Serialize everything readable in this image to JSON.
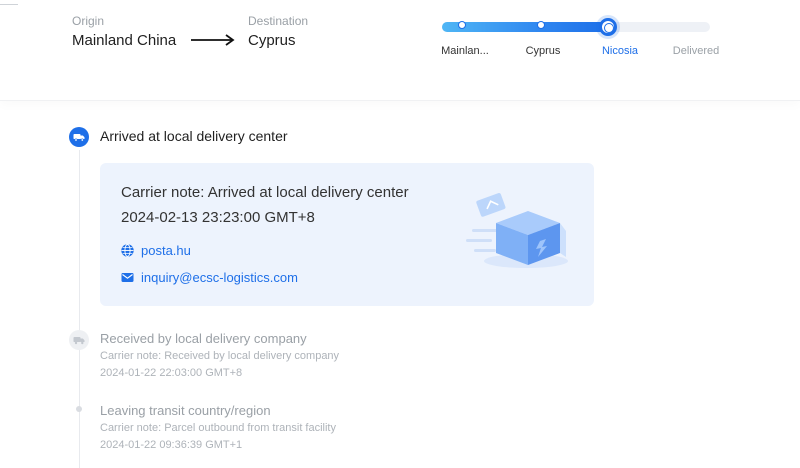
{
  "route": {
    "origin_label": "Origin",
    "origin_value": "Mainland China",
    "destination_label": "Destination",
    "destination_value": "Cyprus"
  },
  "progress": {
    "stages": [
      "Mainlan...",
      "Cyprus",
      "Nicosia",
      "Delivered"
    ],
    "current_stage": "Nicosia",
    "fill_fraction": 0.62
  },
  "events": [
    {
      "title": "Arrived at local delivery center",
      "note": "Carrier note: Arrived at local delivery center",
      "time": "2024-02-13 23:23:00 GMT+8",
      "website": "posta.hu",
      "email": "inquiry@ecsc-logistics.com",
      "status": "current"
    },
    {
      "title": "Received by local delivery company",
      "note": "Carrier note: Received by local delivery company",
      "time": "2024-01-22 22:03:00 GMT+8",
      "status": "past"
    },
    {
      "title": "Leaving transit country/region",
      "note": "Carrier note: Parcel outbound from transit facility",
      "time": "2024-01-22 09:36:39 GMT+1",
      "status": "past"
    }
  ],
  "icons": {
    "current_event": "truck-icon",
    "past_event": "truck-icon",
    "website": "globe-icon",
    "email": "envelope-icon",
    "illustration": "package-box-illustration"
  },
  "colors": {
    "accent": "#1e6fe8",
    "card_bg": "#edf3fd",
    "muted_text": "#9aa0a6"
  }
}
